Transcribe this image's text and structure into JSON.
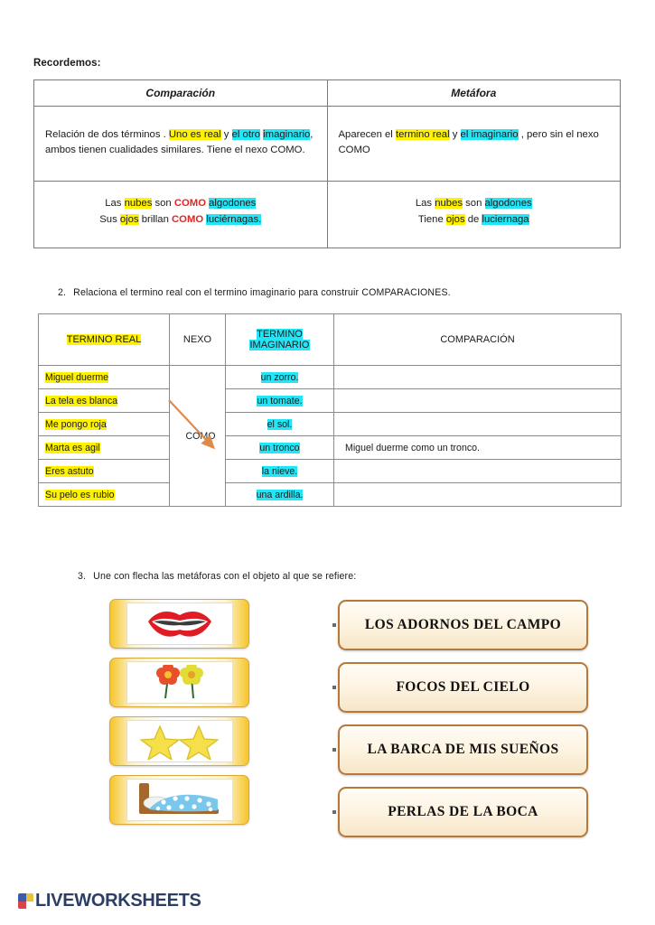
{
  "section1": {
    "label": "Recordemos:",
    "headers": [
      "Comparación",
      "Metáfora"
    ],
    "comparacion_def": {
      "parts": [
        {
          "t": "Relación  de  dos  términos . ",
          "hl": "none"
        },
        {
          "t": "Uno  es real",
          "hl": "yellow"
        },
        {
          "t": " y ",
          "hl": "none"
        },
        {
          "t": "el  otro",
          "hl": "cyan"
        },
        {
          "t": " ",
          "hl": "none"
        },
        {
          "t": "imaginario",
          "hl": "cyan"
        },
        {
          "t": ", ambos tienen cualidades  similares. Tiene el  nexo COMO.",
          "hl": "none"
        }
      ]
    },
    "metafora_def": {
      "parts": [
        {
          "t": "Aparecen el ",
          "hl": "none"
        },
        {
          "t": "termino real",
          "hl": "yellow"
        },
        {
          "t": " y ",
          "hl": "none"
        },
        {
          "t": "el  imaginario",
          "hl": "cyan"
        },
        {
          "t": " , pero sin el nexo COMO",
          "hl": "none"
        }
      ]
    },
    "comparacion_examples": [
      [
        {
          "t": "Las ",
          "hl": "none"
        },
        {
          "t": "nubes",
          "hl": "yellow"
        },
        {
          "t": " son ",
          "hl": "none"
        },
        {
          "t": "COMO",
          "hl": "red"
        },
        {
          "t": " ",
          "hl": "none"
        },
        {
          "t": "algodones",
          "hl": "cyan"
        }
      ],
      [
        {
          "t": "Sus ",
          "hl": "none"
        },
        {
          "t": "ojos",
          "hl": "yellow"
        },
        {
          "t": " brillan ",
          "hl": "none"
        },
        {
          "t": "COMO",
          "hl": "red"
        },
        {
          "t": " ",
          "hl": "none"
        },
        {
          "t": "luciérnagas.",
          "hl": "cyan"
        }
      ]
    ],
    "metafora_examples": [
      [
        {
          "t": "Las ",
          "hl": "none"
        },
        {
          "t": "nubes",
          "hl": "yellow"
        },
        {
          "t": " son  ",
          "hl": "none"
        },
        {
          "t": "algodones",
          "hl": "cyan"
        }
      ],
      [
        {
          "t": "Tiene ",
          "hl": "none"
        },
        {
          "t": "ojos",
          "hl": "yellow"
        },
        {
          "t": " de ",
          "hl": "none"
        },
        {
          "t": "luciernaga",
          "hl": "cyan"
        }
      ]
    ]
  },
  "section2": {
    "number": "2.",
    "instruction": "Relaciona  el  termino real con el  termino imaginario  para  construir COMPARACIONES.",
    "headers": {
      "termino_real": "TERMINO REAL",
      "nexo": "NEXO",
      "termino_imaginario_line1": "TERMINO",
      "termino_imaginario_line2": "IMAGINARIO",
      "comparacion": "COMPARACIÓN"
    },
    "nexo_value": "COMO",
    "rows": [
      {
        "real": "Miguel duerme",
        "imaginario": "un zorro.",
        "comparacion": ""
      },
      {
        "real": "La  tela  es blanca",
        "imaginario": "un  tomate.",
        "comparacion": ""
      },
      {
        "real": "Me  pongo roja",
        "imaginario": "el sol.",
        "comparacion": ""
      },
      {
        "real": "Marta es  agil",
        "imaginario": "un tronco",
        "comparacion": "Miguel  duerme como un  tronco."
      },
      {
        "real": "Eres astuto",
        "imaginario": "la nieve.",
        "comparacion": ""
      },
      {
        "real": "Su  pelo es  rubio",
        "imaginario": "una ardilla.",
        "comparacion": ""
      }
    ],
    "arrow_color": "#e08a4a"
  },
  "section3": {
    "number": "3.",
    "instruction": "Une  con  flecha  las  metáforas   con el objeto al  que se  refiere:",
    "pictures": [
      {
        "icon": "lips-icon",
        "label": "boca"
      },
      {
        "icon": "flowers-icon",
        "label": "flores"
      },
      {
        "icon": "stars-icon",
        "label": "estrellas"
      },
      {
        "icon": "bed-icon",
        "label": "cama"
      }
    ],
    "metaphors": [
      "LOS ADORNOS DEL  CAMPO",
      "FOCOS DEL  CIELO",
      "LA BARCA DE MIS SUEÑOS",
      "PERLAS DE  LA  BOCA"
    ]
  },
  "footer": {
    "brand": "LIVEWORKSHEETS",
    "brand_color": "#2c3e63",
    "logo_colors": [
      "#3b5ca8",
      "#e8c33a",
      "#d9434a",
      "#ffffff"
    ]
  }
}
